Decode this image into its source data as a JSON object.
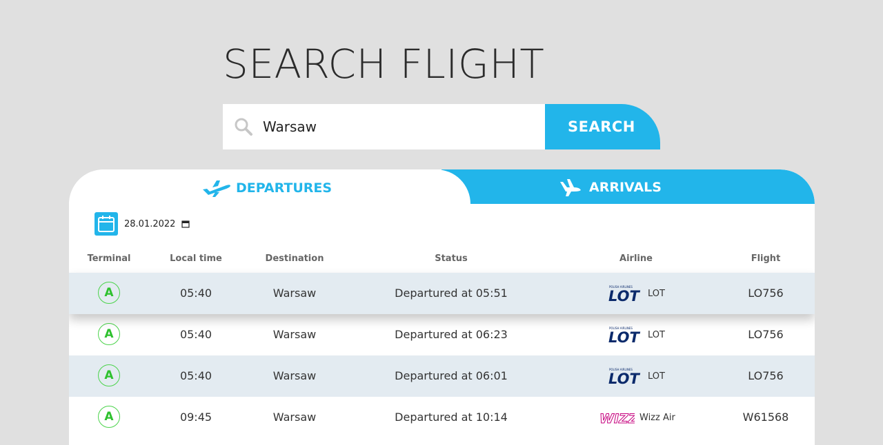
{
  "header": {
    "title": "SEARCH FLIGHT"
  },
  "search": {
    "value": "Warsaw",
    "button_label": "SEARCH"
  },
  "tabs": {
    "departures": "DEPARTURES",
    "arrivals": "ARRIVALS"
  },
  "date": "28.01.2022",
  "table": {
    "columns": [
      "Terminal",
      "Local time",
      "Destination",
      "Status",
      "Airline",
      "Flight"
    ],
    "rows": [
      {
        "terminal": "A",
        "time": "05:40",
        "destination": "Warsaw",
        "status": "Departured at 05:51",
        "airline": "LOT",
        "logo": "lot-logo",
        "flight": "LO756"
      },
      {
        "terminal": "A",
        "time": "05:40",
        "destination": "Warsaw",
        "status": "Departured at 06:23",
        "airline": "LOT",
        "logo": "lot-logo",
        "flight": "LO756"
      },
      {
        "terminal": "A",
        "time": "05:40",
        "destination": "Warsaw",
        "status": "Departured at 06:01",
        "airline": "LOT",
        "logo": "lot-logo",
        "flight": "LO756"
      },
      {
        "terminal": "A",
        "time": "09:45",
        "destination": "Warsaw",
        "status": "Departured at 10:14",
        "airline": "Wizz Air",
        "logo": "wizz-logo",
        "flight": "W61568"
      }
    ]
  },
  "logos": {
    "lot_small_text": "POLISH AIRLINES",
    "lot_text": "LOT",
    "wizz_text": "WIZZ"
  },
  "colors": {
    "accent": "#22b5ea",
    "terminal": "#2fc12f",
    "row_alt": "#e3ebf1",
    "lot_navy": "#0b2a6b",
    "wizz_pink": "#c6007e"
  },
  "icons": {
    "search": "search-icon",
    "departures": "plane-departure-icon",
    "arrivals": "plane-arrival-icon",
    "calendar": "calendar-icon"
  }
}
